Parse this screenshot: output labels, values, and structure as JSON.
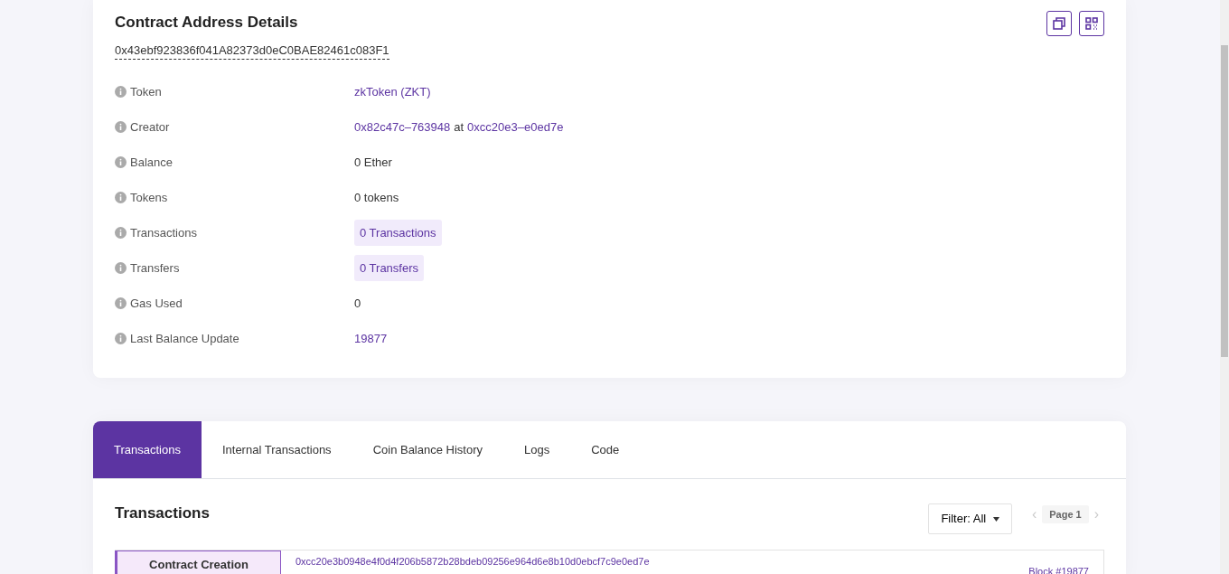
{
  "details": {
    "title": "Contract Address Details",
    "address": "0x43ebf923836f041A82373d0eC0BAE82461c083F1",
    "rows": [
      {
        "label": "Token",
        "parts": [
          {
            "kind": "link",
            "text": "zkToken (ZKT)"
          }
        ]
      },
      {
        "label": "Creator",
        "parts": [
          {
            "kind": "link",
            "text": "0x82c47c–763948"
          },
          {
            "kind": "text",
            "text": "at"
          },
          {
            "kind": "link",
            "text": "0xcc20e3–e0ed7e"
          }
        ]
      },
      {
        "label": "Balance",
        "parts": [
          {
            "kind": "text",
            "text": "0 Ether"
          }
        ]
      },
      {
        "label": "Tokens",
        "parts": [
          {
            "kind": "text",
            "text": "0 tokens"
          }
        ]
      },
      {
        "label": "Transactions",
        "parts": [
          {
            "kind": "badge",
            "text": "0 Transactions"
          }
        ]
      },
      {
        "label": "Transfers",
        "parts": [
          {
            "kind": "badge",
            "text": "0 Transfers"
          }
        ]
      },
      {
        "label": "Gas Used",
        "parts": [
          {
            "kind": "text",
            "text": "0"
          }
        ]
      },
      {
        "label": "Last Balance Update",
        "parts": [
          {
            "kind": "link",
            "text": "19877"
          }
        ]
      }
    ]
  },
  "tabs": [
    {
      "label": "Transactions",
      "selected": true
    },
    {
      "label": "Internal Transactions",
      "selected": false
    },
    {
      "label": "Coin Balance History",
      "selected": false
    },
    {
      "label": "Logs",
      "selected": false
    },
    {
      "label": "Code",
      "selected": false
    }
  ],
  "transactions": {
    "title": "Transactions",
    "filter": "Filter: All",
    "pager": {
      "prev": "‹",
      "page": "Page 1",
      "next": "›",
      "disabled": true
    },
    "items": [
      {
        "type": "Contract Creation",
        "hash": "0xcc20e3b0948e4f0d4f206b5872b28bdeb09256e964d6e8b10d0ebcf7c9e0ed7e",
        "block": "Block #19877"
      }
    ]
  }
}
